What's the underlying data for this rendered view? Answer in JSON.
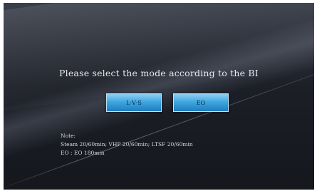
{
  "screen": {
    "title": "Please select the mode according to the BI",
    "buttons": {
      "lvs_label": "L·V·S",
      "eo_label": "EO"
    },
    "note": {
      "heading": "Note:",
      "line1": "Steam 20/60min; VHP 20/60min; LTSF 20/60min",
      "line2": "EO : EO 180min"
    }
  },
  "colors": {
    "background": "#1c1f27",
    "button_accent": "#3fa7e0",
    "text": "#e6e8ee"
  }
}
